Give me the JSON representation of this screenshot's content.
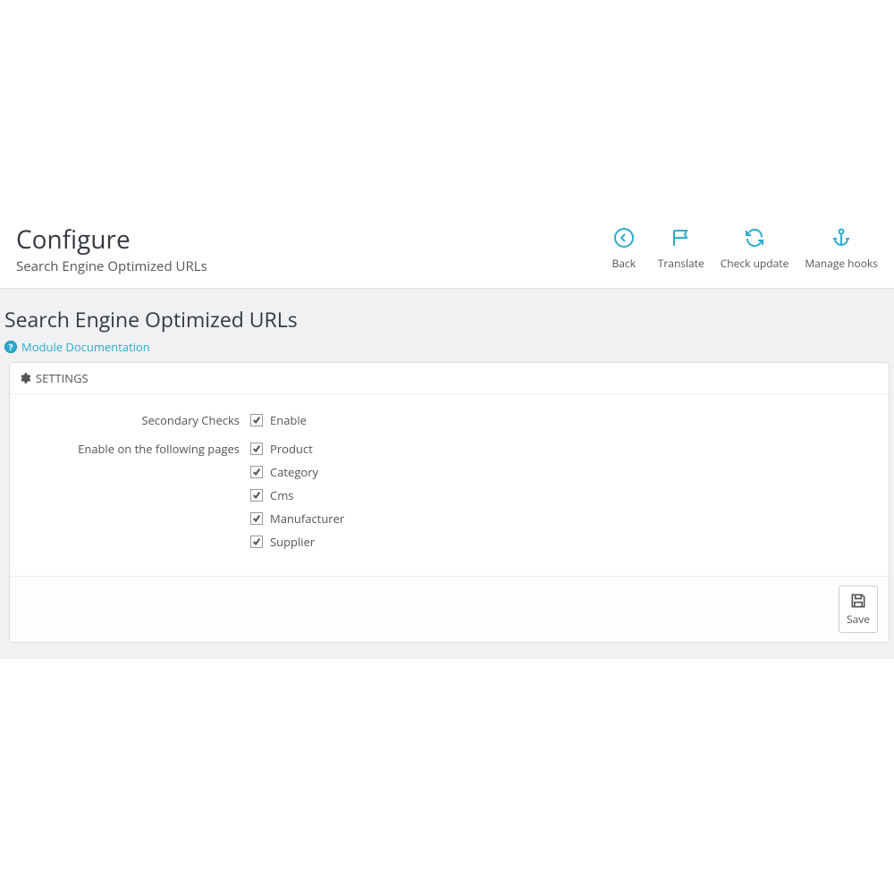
{
  "header": {
    "title": "Configure",
    "subtitle": "Search Engine Optimized URLs"
  },
  "toolbar": {
    "back": "Back",
    "translate": "Translate",
    "check_update": "Check update",
    "manage_hooks": "Manage hooks"
  },
  "page": {
    "title": "Search Engine Optimized URLs",
    "doc_link": "Module Documentation"
  },
  "panel": {
    "heading": "SETTINGS",
    "secondary_checks_label": "Secondary Checks",
    "enable_label": "Enable",
    "pages_label": "Enable on the following pages",
    "pages": {
      "product": "Product",
      "category": "Category",
      "cms": "Cms",
      "manufacturer": "Manufacturer",
      "supplier": "Supplier"
    },
    "save": "Save"
  }
}
